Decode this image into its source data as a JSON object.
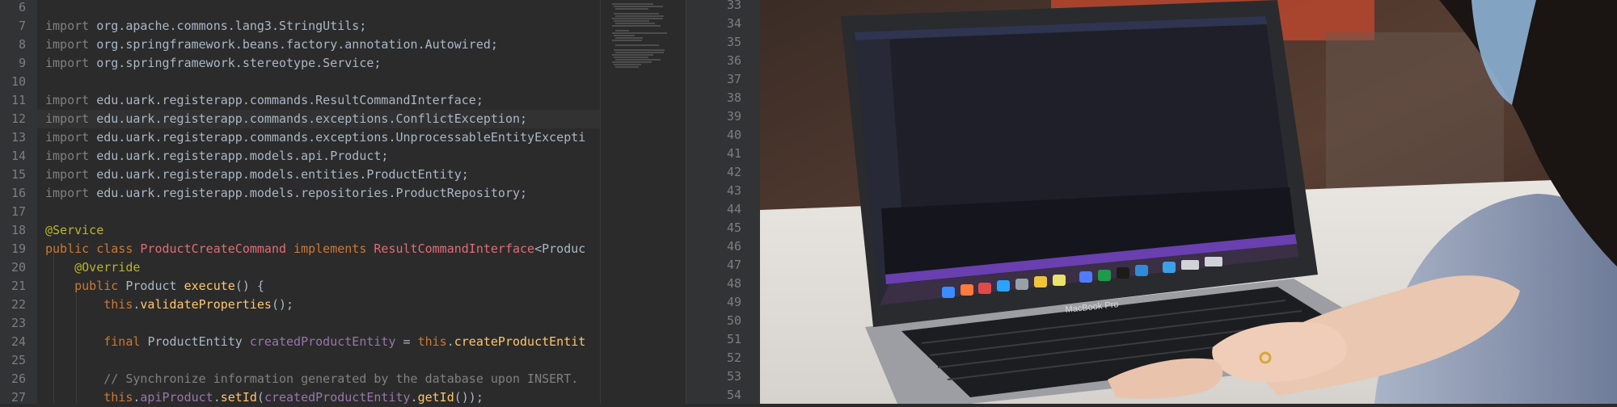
{
  "editor": {
    "lines": [
      {
        "num": "6",
        "segments": []
      },
      {
        "num": "7",
        "segments": [
          {
            "t": "import ",
            "c": "imp"
          },
          {
            "t": "org.apache.commons.lang3.StringUtils;",
            "c": ""
          }
        ]
      },
      {
        "num": "8",
        "segments": [
          {
            "t": "import ",
            "c": "imp"
          },
          {
            "t": "org.springframework.beans.factory.annotation.Autowired;",
            "c": ""
          }
        ]
      },
      {
        "num": "9",
        "segments": [
          {
            "t": "import ",
            "c": "imp"
          },
          {
            "t": "org.springframework.stereotype.Service;",
            "c": ""
          }
        ]
      },
      {
        "num": "10",
        "segments": []
      },
      {
        "num": "11",
        "segments": [
          {
            "t": "import ",
            "c": "imp"
          },
          {
            "t": "edu.uark.registerapp.commands.ResultCommandInterface;",
            "c": ""
          }
        ]
      },
      {
        "num": "12",
        "segments": [
          {
            "t": "import ",
            "c": "imp"
          },
          {
            "t": "edu.uark.registerapp.commands.exceptions.ConflictException;",
            "c": ""
          }
        ]
      },
      {
        "num": "13",
        "segments": [
          {
            "t": "import ",
            "c": "imp"
          },
          {
            "t": "edu.uark.registerapp.commands.exceptions.UnprocessableEntityExcepti",
            "c": ""
          }
        ]
      },
      {
        "num": "14",
        "segments": [
          {
            "t": "import ",
            "c": "imp"
          },
          {
            "t": "edu.uark.registerapp.models.api.Product;",
            "c": ""
          }
        ]
      },
      {
        "num": "15",
        "segments": [
          {
            "t": "import ",
            "c": "imp"
          },
          {
            "t": "edu.uark.registerapp.models.entities.ProductEntity;",
            "c": ""
          }
        ]
      },
      {
        "num": "16",
        "segments": [
          {
            "t": "import ",
            "c": "imp"
          },
          {
            "t": "edu.uark.registerapp.models.repositories.ProductRepository;",
            "c": ""
          }
        ]
      },
      {
        "num": "17",
        "segments": []
      },
      {
        "num": "18",
        "segments": [
          {
            "t": "@Service",
            "c": "ann"
          }
        ]
      },
      {
        "num": "19",
        "segments": [
          {
            "t": "public class ",
            "c": "kw"
          },
          {
            "t": "ProductCreateCommand",
            "c": "cls"
          },
          {
            "t": " implements ",
            "c": "kw"
          },
          {
            "t": "ResultCommandInterface",
            "c": "cls"
          },
          {
            "t": "<Produc",
            "c": ""
          }
        ]
      },
      {
        "num": "20",
        "segments": [
          {
            "t": "    ",
            "c": ""
          },
          {
            "t": "@Override",
            "c": "ann"
          }
        ]
      },
      {
        "num": "21",
        "segments": [
          {
            "t": "    ",
            "c": ""
          },
          {
            "t": "public ",
            "c": "kw"
          },
          {
            "t": "Product ",
            "c": ""
          },
          {
            "t": "execute",
            "c": "fn"
          },
          {
            "t": "() {",
            "c": ""
          }
        ]
      },
      {
        "num": "22",
        "segments": [
          {
            "t": "        ",
            "c": ""
          },
          {
            "t": "this",
            "c": "kw"
          },
          {
            "t": ".",
            "c": ""
          },
          {
            "t": "validateProperties",
            "c": "fn"
          },
          {
            "t": "();",
            "c": ""
          }
        ]
      },
      {
        "num": "23",
        "segments": []
      },
      {
        "num": "24",
        "segments": [
          {
            "t": "        ",
            "c": ""
          },
          {
            "t": "final ",
            "c": "kw"
          },
          {
            "t": "ProductEntity ",
            "c": ""
          },
          {
            "t": "createdProductEntity",
            "c": "var"
          },
          {
            "t": " = ",
            "c": ""
          },
          {
            "t": "this",
            "c": "kw"
          },
          {
            "t": ".",
            "c": ""
          },
          {
            "t": "createProductEntit",
            "c": "fn"
          }
        ]
      },
      {
        "num": "25",
        "segments": []
      },
      {
        "num": "26",
        "segments": [
          {
            "t": "        ",
            "c": ""
          },
          {
            "t": "// Synchronize information generated by the database upon INSERT.",
            "c": "cm"
          }
        ]
      },
      {
        "num": "27",
        "segments": [
          {
            "t": "        ",
            "c": ""
          },
          {
            "t": "this",
            "c": "kw"
          },
          {
            "t": ".",
            "c": ""
          },
          {
            "t": "apiProduct",
            "c": "var"
          },
          {
            "t": ".",
            "c": ""
          },
          {
            "t": "setId",
            "c": "fn"
          },
          {
            "t": "(",
            "c": ""
          },
          {
            "t": "createdProductEntity",
            "c": "var"
          },
          {
            "t": ".",
            "c": ""
          },
          {
            "t": "getId",
            "c": "fn"
          },
          {
            "t": "());",
            "c": ""
          }
        ]
      }
    ],
    "right_gutter": [
      "33",
      "34",
      "35",
      "36",
      "37",
      "38",
      "39",
      "40",
      "41",
      "42",
      "43",
      "44",
      "45",
      "46",
      "47",
      "48",
      "49",
      "50",
      "51",
      "52",
      "53",
      "54"
    ]
  },
  "photo": {
    "laptop_brand": "MacBook Pro"
  },
  "colors": {
    "editor_bg": "#2b2b2b",
    "gutter_bg": "#313335",
    "keyword": "#cc7832",
    "annotation": "#bbb529",
    "class_highlight": "#e06c75",
    "function": "#ffc66d",
    "variable": "#9876aa"
  }
}
